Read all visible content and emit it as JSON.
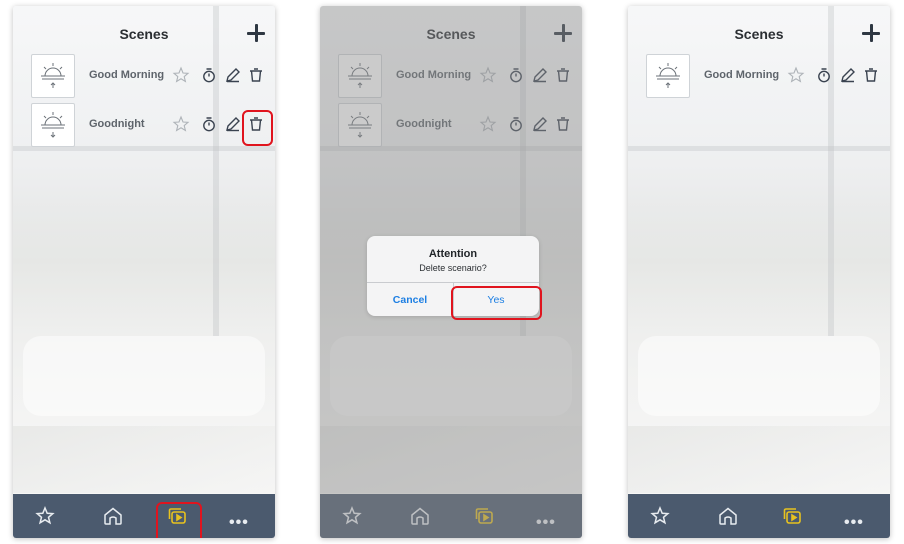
{
  "screen": {
    "title": "Scenes",
    "add_icon": "plus-icon",
    "scenes": [
      {
        "name": "Good Morning",
        "thumbnail": "sunrise-icon"
      },
      {
        "name": "Goodnight",
        "thumbnail": "sunset-icon"
      }
    ],
    "row_actions": [
      "favorite-star-icon",
      "timer-icon",
      "edit-pencil-icon",
      "delete-trash-icon"
    ],
    "nav": [
      "favorites-star-icon",
      "home-icon",
      "scenes-icon",
      "more-icon"
    ],
    "more_label": "•••"
  },
  "dialog": {
    "title": "Attention",
    "message": "Delete scenario?",
    "cancel": "Cancel",
    "confirm": "Yes"
  },
  "colors": {
    "navbar": "#4b5a6e",
    "nav_icon": "#e8ecf0",
    "active_nav_icon": "#e8c21f",
    "highlight": "#e0141e",
    "dialog_link": "#1d7fe3",
    "title": "#2b2f33"
  }
}
